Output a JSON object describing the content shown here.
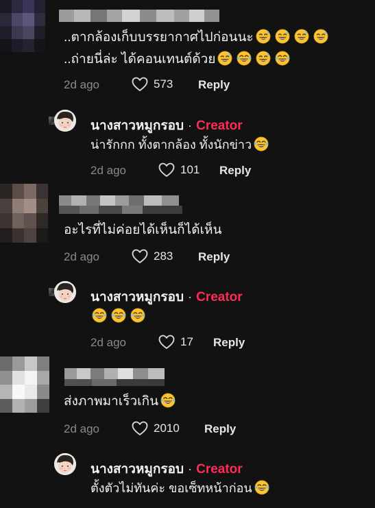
{
  "comments": [
    {
      "text_line1": "..ตากล้องเก็บบรรยากาศไปก่อนนะ",
      "text_line2": "..ถ่ายนี่ล่ะ ได้คอนเทนต์ด้วย",
      "time": "2d ago",
      "likes": "573",
      "reply_label": "Reply",
      "reply": {
        "author": "นางสาวหมูกรอบ",
        "separator": "·",
        "badge": "Creator",
        "text": "น่ารักกก ทั้งตากล้อง ทั้งนักข่าว",
        "time": "2d ago",
        "likes": "101",
        "reply_label": "Reply"
      }
    },
    {
      "text_line1": "อะไรที่ไม่ค่อยได้เห็นก็ได้เห็น",
      "time": "2d ago",
      "likes": "283",
      "reply_label": "Reply",
      "reply": {
        "author": "นางสาวหมูกรอบ",
        "separator": "·",
        "badge": "Creator",
        "text": "",
        "time": "2d ago",
        "likes": "17",
        "reply_label": "Reply"
      }
    },
    {
      "text_line1": "ส่งภาพมาเร็วเกิน",
      "time": "2d ago",
      "likes": "2010",
      "reply_label": "Reply",
      "reply": {
        "author": "นางสาวหมูกรอบ",
        "separator": "·",
        "badge": "Creator",
        "text": "ตั้งตัวไม่ทันค่ะ ขอเซ็ทหน้าก่อน"
      }
    }
  ],
  "icons": {
    "emoji_sweat": "grinning-face-with-sweat-emoji",
    "emoji_joy": "face-with-tears-of-joy-emoji",
    "heart": "heart-outline-icon"
  },
  "colors": {
    "background": "#121212",
    "creator_badge": "#fe2c55",
    "muted": "#8a8a8a"
  }
}
